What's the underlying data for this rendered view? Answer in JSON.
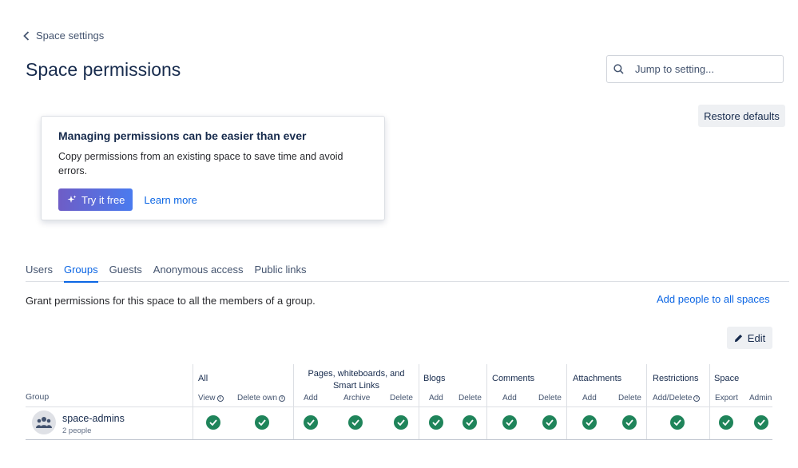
{
  "nav": {
    "back_label": "Space settings"
  },
  "page": {
    "title": "Space permissions"
  },
  "search": {
    "placeholder": "Jump to setting..."
  },
  "restore_label": "Restore defaults",
  "promo": {
    "title": "Managing permissions can be easier than ever",
    "body": "Copy permissions from an existing space to save time and avoid errors.",
    "try_label": "Try it free",
    "learn_label": "Learn more"
  },
  "tabs": [
    {
      "label": "Users",
      "active": false
    },
    {
      "label": "Groups",
      "active": true
    },
    {
      "label": "Guests",
      "active": false
    },
    {
      "label": "Anonymous access",
      "active": false
    },
    {
      "label": "Public links",
      "active": false
    }
  ],
  "grant_text": "Grant permissions for this space to all the members of a group.",
  "add_all_label": "Add people to all spaces",
  "edit_label": "Edit",
  "table": {
    "group_header": "Group",
    "categories": {
      "all": "All",
      "pages": "Pages, whiteboards, and Smart Links",
      "blogs": "Blogs",
      "comments": "Comments",
      "attachments": "Attachments",
      "restrictions": "Restrictions",
      "space": "Space"
    },
    "columns": {
      "view": "View",
      "delete_own": "Delete own",
      "pages_add": "Add",
      "pages_archive": "Archive",
      "pages_delete": "Delete",
      "blogs_add": "Add",
      "blogs_delete": "Delete",
      "comments_add": "Add",
      "comments_delete": "Delete",
      "attachments_add": "Add",
      "attachments_delete": "Delete",
      "restrictions_add_delete": "Add/Delete",
      "space_export": "Export",
      "space_admin": "Admin"
    },
    "rows": [
      {
        "name": "space-admins",
        "count": "2 people",
        "permissions_granted": [
          true,
          true,
          true,
          true,
          true,
          true,
          true,
          true,
          true,
          true,
          true,
          true,
          true,
          true
        ]
      }
    ]
  },
  "colors": {
    "accent": "#0c66e4",
    "check": "#1f845a",
    "promo_gradient_start": "#6e5dc6",
    "promo_gradient_end": "#4a7bef"
  },
  "icons": {
    "back": "chevron-left-icon",
    "search": "search-icon",
    "sparkle": "sparkle-icon",
    "edit": "pencil-icon",
    "group_avatar": "people-icon",
    "check": "check-circle-icon",
    "info": "info-icon"
  }
}
